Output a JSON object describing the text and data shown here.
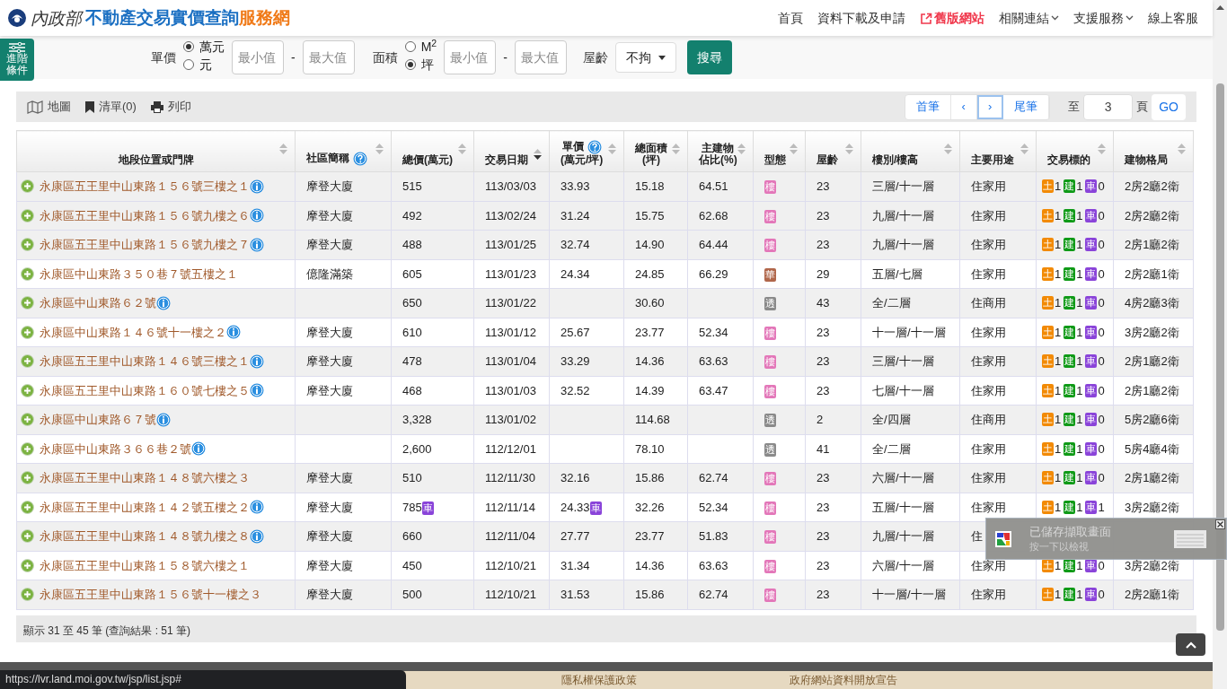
{
  "brand": {
    "ministry": "內政部",
    "title": "不動產交易實價查詢",
    "suffix": "服務網"
  },
  "nav": [
    {
      "label": "首頁",
      "kind": "plain"
    },
    {
      "label": "資料下載及申請",
      "kind": "plain"
    },
    {
      "label": "舊版網站",
      "kind": "external"
    },
    {
      "label": "相關連結",
      "kind": "dropdown"
    },
    {
      "label": "支援服務",
      "kind": "dropdown"
    },
    {
      "label": "線上客服",
      "kind": "plain"
    }
  ],
  "filters": {
    "advanced": "進階條件",
    "unit_price": {
      "label": "單價",
      "options": [
        {
          "label": "萬元",
          "selected": true
        },
        {
          "label": "元",
          "selected": false
        }
      ],
      "min_placeholder": "最小值",
      "max_placeholder": "最大值"
    },
    "area": {
      "label": "面積",
      "options": [
        {
          "label": "M$^{2}$",
          "selected": false
        },
        {
          "label": "坪",
          "selected": true
        }
      ],
      "min_placeholder": "最小值",
      "max_placeholder": "最大值"
    },
    "dash": "-",
    "age": {
      "label": "屋齡",
      "value": "不拘"
    },
    "search": "搜尋"
  },
  "toolbar": [
    {
      "label": "地圖"
    },
    {
      "label": "清單(0)"
    },
    {
      "label": "列印"
    }
  ],
  "pager": {
    "buttons": [
      {
        "label": "首筆",
        "focused": false
      },
      {
        "label": "‹",
        "focused": false
      },
      {
        "label": "›",
        "focused": true
      },
      {
        "label": "尾筆",
        "focused": false
      }
    ],
    "to": "至",
    "page": "3",
    "page_unit": "頁",
    "go": "GO"
  },
  "table": {
    "columns": [
      {
        "lines": [
          "地段位置或門牌"
        ],
        "help": false,
        "sorted": false
      },
      {
        "lines": [
          "社區簡稱"
        ],
        "help": true,
        "sorted": false
      },
      {
        "lines": [
          "總價(萬元)"
        ],
        "help": false,
        "sorted": false
      },
      {
        "lines": [
          "交易日期"
        ],
        "help": false,
        "sorted": true
      },
      {
        "lines": [
          "單價",
          "(萬元/坪)"
        ],
        "help": true,
        "sorted": false
      },
      {
        "lines": [
          "總面積",
          "(坪)"
        ],
        "help": false,
        "sorted": false
      },
      {
        "lines": [
          "主建物",
          "佔比(%)"
        ],
        "help": false,
        "sorted": false
      },
      {
        "lines": [
          "型態"
        ],
        "help": false,
        "sorted": false
      },
      {
        "lines": [
          "屋齡"
        ],
        "help": false,
        "sorted": false
      },
      {
        "lines": [
          "樓別/樓高"
        ],
        "help": false,
        "sorted": false
      },
      {
        "lines": [
          "主要用途"
        ],
        "help": false,
        "sorted": false
      },
      {
        "lines": [
          "交易標的"
        ],
        "help": false,
        "sorted": false
      },
      {
        "lines": [
          "建物格局"
        ],
        "help": false,
        "sorted": false
      }
    ],
    "rows": [
      {
        "shaded": true,
        "address": "永康區五王里中山東路１５６號三樓之１",
        "info": true,
        "community": "摩登大廈",
        "total": "515",
        "date": "113/03/03",
        "unit": "33.93",
        "area": "15.18",
        "ratio": "64.51",
        "type": {
          "label": "樓",
          "color": "#e377b9"
        },
        "age": "23",
        "floor": "三層/十一層",
        "use": "住家用",
        "tx": [
          {
            "label": "土",
            "count": "1"
          },
          {
            "label": "建",
            "count": "1"
          },
          {
            "label": "車",
            "count": "0"
          }
        ],
        "layout": "2房2廳2衛"
      },
      {
        "shaded": true,
        "address": "永康區五王里中山東路１５６號九樓之６",
        "info": true,
        "community": "摩登大廈",
        "total": "492",
        "date": "113/02/24",
        "unit": "31.24",
        "area": "15.75",
        "ratio": "62.68",
        "type": {
          "label": "樓",
          "color": "#e377b9"
        },
        "age": "23",
        "floor": "九層/十一層",
        "use": "住家用",
        "tx": [
          {
            "label": "土",
            "count": "1"
          },
          {
            "label": "建",
            "count": "1"
          },
          {
            "label": "車",
            "count": "0"
          }
        ],
        "layout": "2房2廳2衛"
      },
      {
        "shaded": true,
        "address": "永康區五王里中山東路１５６號九樓之７",
        "info": true,
        "community": "摩登大廈",
        "total": "488",
        "date": "113/01/25",
        "unit": "32.74",
        "area": "14.90",
        "ratio": "64.44",
        "type": {
          "label": "樓",
          "color": "#e377b9"
        },
        "age": "23",
        "floor": "九層/十一層",
        "use": "住家用",
        "tx": [
          {
            "label": "土",
            "count": "1"
          },
          {
            "label": "建",
            "count": "1"
          },
          {
            "label": "車",
            "count": "0"
          }
        ],
        "layout": "2房1廳2衛"
      },
      {
        "shaded": false,
        "address": "永康區中山東路３５０巷７號五樓之１",
        "info": false,
        "community": "億隆滿築",
        "total": "605",
        "date": "113/01/23",
        "unit": "24.34",
        "area": "24.85",
        "ratio": "66.29",
        "type": {
          "label": "華",
          "color": "#b0664a"
        },
        "age": "29",
        "floor": "五層/七層",
        "use": "住家用",
        "tx": [
          {
            "label": "土",
            "count": "1"
          },
          {
            "label": "建",
            "count": "1"
          },
          {
            "label": "車",
            "count": "0"
          }
        ],
        "layout": "2房2廳1衛"
      },
      {
        "shaded": true,
        "address": "永康區中山東路６２號",
        "info": true,
        "total": "650",
        "date": "113/01/22",
        "area": "30.60",
        "type": {
          "label": "透",
          "color": "#8a8a8a"
        },
        "age": "43",
        "floor": "全/二層",
        "use": "住商用",
        "tx": [
          {
            "label": "土",
            "count": "1"
          },
          {
            "label": "建",
            "count": "1"
          },
          {
            "label": "車",
            "count": "0"
          }
        ],
        "layout": "4房2廳3衛"
      },
      {
        "shaded": false,
        "address": "永康區中山東路１４６號十一樓之２",
        "info": true,
        "community": "摩登大廈",
        "total": "610",
        "date": "113/01/12",
        "unit": "25.67",
        "area": "23.77",
        "ratio": "52.34",
        "type": {
          "label": "樓",
          "color": "#e377b9"
        },
        "age": "23",
        "floor": "十一層/十一層",
        "use": "住家用",
        "tx": [
          {
            "label": "土",
            "count": "1"
          },
          {
            "label": "建",
            "count": "1"
          },
          {
            "label": "車",
            "count": "0"
          }
        ],
        "layout": "3房2廳2衛"
      },
      {
        "shaded": true,
        "address": "永康區五王里中山東路１４６號三樓之１",
        "info": true,
        "community": "摩登大廈",
        "total": "478",
        "date": "113/01/04",
        "unit": "33.29",
        "area": "14.36",
        "ratio": "63.63",
        "type": {
          "label": "樓",
          "color": "#e377b9"
        },
        "age": "23",
        "floor": "三層/十一層",
        "use": "住家用",
        "tx": [
          {
            "label": "土",
            "count": "1"
          },
          {
            "label": "建",
            "count": "1"
          },
          {
            "label": "車",
            "count": "0"
          }
        ],
        "layout": "2房1廳2衛"
      },
      {
        "shaded": false,
        "address": "永康區五王里中山東路１６０號七樓之５",
        "info": true,
        "community": "摩登大廈",
        "total": "468",
        "date": "113/01/03",
        "unit": "32.52",
        "area": "14.39",
        "ratio": "63.47",
        "type": {
          "label": "樓",
          "color": "#e377b9"
        },
        "age": "23",
        "floor": "七層/十一層",
        "use": "住家用",
        "tx": [
          {
            "label": "土",
            "count": "1"
          },
          {
            "label": "建",
            "count": "1"
          },
          {
            "label": "車",
            "count": "0"
          }
        ],
        "layout": "2房1廳2衛"
      },
      {
        "shaded": true,
        "address": "永康區中山東路６７號",
        "info": true,
        "total": "3,328",
        "date": "113/01/02",
        "area": "114.68",
        "type": {
          "label": "透",
          "color": "#8a8a8a"
        },
        "age": "2",
        "floor": "全/四層",
        "use": "住商用",
        "tx": [
          {
            "label": "土",
            "count": "1"
          },
          {
            "label": "建",
            "count": "1"
          },
          {
            "label": "車",
            "count": "0"
          }
        ],
        "layout": "5房2廳6衛"
      },
      {
        "shaded": false,
        "address": "永康區中山東路３６６巷２號",
        "info": true,
        "total": "2,600",
        "date": "112/12/01",
        "area": "78.10",
        "type": {
          "label": "透",
          "color": "#8a8a8a"
        },
        "age": "41",
        "floor": "全/二層",
        "use": "住家用",
        "tx": [
          {
            "label": "土",
            "count": "1"
          },
          {
            "label": "建",
            "count": "1"
          },
          {
            "label": "車",
            "count": "0"
          }
        ],
        "layout": "5房4廳4衛"
      },
      {
        "shaded": true,
        "address": "永康區五王里中山東路１４８號六樓之３",
        "info": false,
        "community": "摩登大廈",
        "total": "510",
        "date": "112/11/30",
        "unit": "32.16",
        "area": "15.86",
        "ratio": "62.74",
        "type": {
          "label": "樓",
          "color": "#e377b9"
        },
        "age": "23",
        "floor": "六層/十一層",
        "use": "住家用",
        "tx": [
          {
            "label": "土",
            "count": "1"
          },
          {
            "label": "建",
            "count": "1"
          },
          {
            "label": "車",
            "count": "0"
          }
        ],
        "layout": "2房1廳2衛"
      },
      {
        "shaded": false,
        "address": "永康區五王里中山東路１４２號五樓之２",
        "info": true,
        "community": "摩登大廈",
        "total": "785",
        "total_car": "車",
        "date": "112/11/14",
        "unit": "24.33",
        "unit_car": "車",
        "area": "32.26",
        "ratio": "52.34",
        "type": {
          "label": "樓",
          "color": "#e377b9"
        },
        "age": "23",
        "floor": "五層/十一層",
        "use": "住家用",
        "tx": [
          {
            "label": "土",
            "count": "1"
          },
          {
            "label": "建",
            "count": "1"
          },
          {
            "label": "車",
            "count": "1"
          }
        ],
        "layout": "3房2廳2衛"
      },
      {
        "shaded": true,
        "address": "永康區五王里中山東路１４８號九樓之８",
        "info": true,
        "community": "摩登大廈",
        "total": "660",
        "date": "112/11/04",
        "unit": "27.77",
        "area": "23.77",
        "ratio": "51.83",
        "type": {
          "label": "樓",
          "color": "#e377b9"
        },
        "age": "23",
        "floor": "九層/十一層",
        "use": "住"
      },
      {
        "shaded": false,
        "address": "永康區五王里中山東路１５８號六樓之１",
        "info": false,
        "community": "摩登大廈",
        "total": "450",
        "date": "112/10/21",
        "unit": "31.34",
        "area": "14.36",
        "ratio": "63.63",
        "type": {
          "label": "樓",
          "color": "#e377b9"
        },
        "age": "23",
        "floor": "六層/十一層",
        "use": "住家用",
        "tx": [
          {
            "label": "土",
            "count": "1"
          },
          {
            "label": "建",
            "count": "1"
          },
          {
            "label": "車",
            "count": "0"
          }
        ],
        "layout": "3房2廳2衛"
      },
      {
        "shaded": true,
        "address": "永康區五王里中山東路１５６號十一樓之３",
        "info": false,
        "community": "摩登大廈",
        "total": "500",
        "date": "112/10/21",
        "unit": "31.53",
        "area": "15.86",
        "ratio": "62.74",
        "type": {
          "label": "樓",
          "color": "#e377b9"
        },
        "age": "23",
        "floor": "十一層/十一層",
        "use": "住家用",
        "tx": [
          {
            "label": "土",
            "count": "1"
          },
          {
            "label": "建",
            "count": "1"
          },
          {
            "label": "車",
            "count": "0"
          }
        ],
        "layout": "2房2廳1衛"
      }
    ]
  },
  "summary": "顯示 31 至 45 筆 (查詢結果 : 51 筆)",
  "footer_links": [
    "隱私權保護政策",
    "政府網站資料開放宣告"
  ],
  "status_url": "https://lvr.land.moi.gov.tw/jsp/list.jsp#",
  "notification": {
    "title": "已儲存擷取畫面",
    "subtitle": "按一下以檢視"
  }
}
